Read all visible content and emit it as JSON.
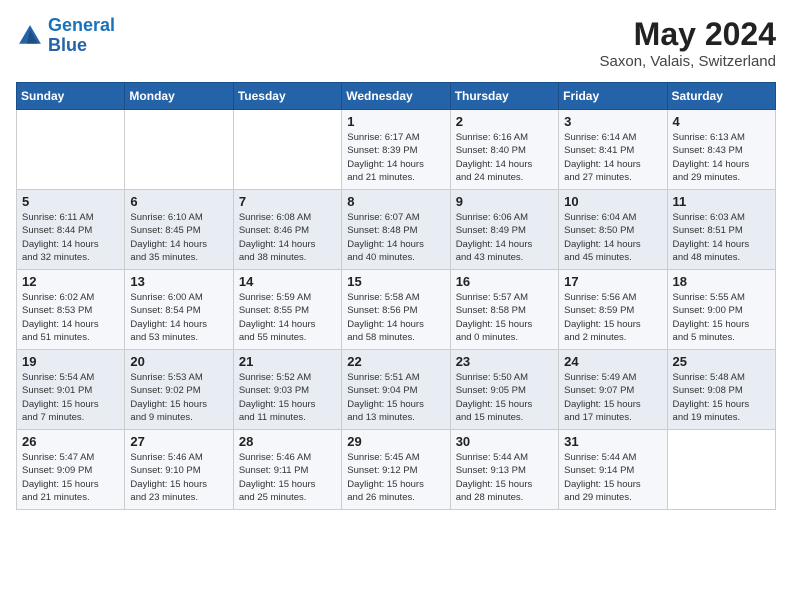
{
  "header": {
    "logo_general": "General",
    "logo_blue": "Blue",
    "month_year": "May 2024",
    "location": "Saxon, Valais, Switzerland"
  },
  "days_of_week": [
    "Sunday",
    "Monday",
    "Tuesday",
    "Wednesday",
    "Thursday",
    "Friday",
    "Saturday"
  ],
  "weeks": [
    [
      {
        "day": "",
        "info": ""
      },
      {
        "day": "",
        "info": ""
      },
      {
        "day": "",
        "info": ""
      },
      {
        "day": "1",
        "info": "Sunrise: 6:17 AM\nSunset: 8:39 PM\nDaylight: 14 hours\nand 21 minutes."
      },
      {
        "day": "2",
        "info": "Sunrise: 6:16 AM\nSunset: 8:40 PM\nDaylight: 14 hours\nand 24 minutes."
      },
      {
        "day": "3",
        "info": "Sunrise: 6:14 AM\nSunset: 8:41 PM\nDaylight: 14 hours\nand 27 minutes."
      },
      {
        "day": "4",
        "info": "Sunrise: 6:13 AM\nSunset: 8:43 PM\nDaylight: 14 hours\nand 29 minutes."
      }
    ],
    [
      {
        "day": "5",
        "info": "Sunrise: 6:11 AM\nSunset: 8:44 PM\nDaylight: 14 hours\nand 32 minutes."
      },
      {
        "day": "6",
        "info": "Sunrise: 6:10 AM\nSunset: 8:45 PM\nDaylight: 14 hours\nand 35 minutes."
      },
      {
        "day": "7",
        "info": "Sunrise: 6:08 AM\nSunset: 8:46 PM\nDaylight: 14 hours\nand 38 minutes."
      },
      {
        "day": "8",
        "info": "Sunrise: 6:07 AM\nSunset: 8:48 PM\nDaylight: 14 hours\nand 40 minutes."
      },
      {
        "day": "9",
        "info": "Sunrise: 6:06 AM\nSunset: 8:49 PM\nDaylight: 14 hours\nand 43 minutes."
      },
      {
        "day": "10",
        "info": "Sunrise: 6:04 AM\nSunset: 8:50 PM\nDaylight: 14 hours\nand 45 minutes."
      },
      {
        "day": "11",
        "info": "Sunrise: 6:03 AM\nSunset: 8:51 PM\nDaylight: 14 hours\nand 48 minutes."
      }
    ],
    [
      {
        "day": "12",
        "info": "Sunrise: 6:02 AM\nSunset: 8:53 PM\nDaylight: 14 hours\nand 51 minutes."
      },
      {
        "day": "13",
        "info": "Sunrise: 6:00 AM\nSunset: 8:54 PM\nDaylight: 14 hours\nand 53 minutes."
      },
      {
        "day": "14",
        "info": "Sunrise: 5:59 AM\nSunset: 8:55 PM\nDaylight: 14 hours\nand 55 minutes."
      },
      {
        "day": "15",
        "info": "Sunrise: 5:58 AM\nSunset: 8:56 PM\nDaylight: 14 hours\nand 58 minutes."
      },
      {
        "day": "16",
        "info": "Sunrise: 5:57 AM\nSunset: 8:58 PM\nDaylight: 15 hours\nand 0 minutes."
      },
      {
        "day": "17",
        "info": "Sunrise: 5:56 AM\nSunset: 8:59 PM\nDaylight: 15 hours\nand 2 minutes."
      },
      {
        "day": "18",
        "info": "Sunrise: 5:55 AM\nSunset: 9:00 PM\nDaylight: 15 hours\nand 5 minutes."
      }
    ],
    [
      {
        "day": "19",
        "info": "Sunrise: 5:54 AM\nSunset: 9:01 PM\nDaylight: 15 hours\nand 7 minutes."
      },
      {
        "day": "20",
        "info": "Sunrise: 5:53 AM\nSunset: 9:02 PM\nDaylight: 15 hours\nand 9 minutes."
      },
      {
        "day": "21",
        "info": "Sunrise: 5:52 AM\nSunset: 9:03 PM\nDaylight: 15 hours\nand 11 minutes."
      },
      {
        "day": "22",
        "info": "Sunrise: 5:51 AM\nSunset: 9:04 PM\nDaylight: 15 hours\nand 13 minutes."
      },
      {
        "day": "23",
        "info": "Sunrise: 5:50 AM\nSunset: 9:05 PM\nDaylight: 15 hours\nand 15 minutes."
      },
      {
        "day": "24",
        "info": "Sunrise: 5:49 AM\nSunset: 9:07 PM\nDaylight: 15 hours\nand 17 minutes."
      },
      {
        "day": "25",
        "info": "Sunrise: 5:48 AM\nSunset: 9:08 PM\nDaylight: 15 hours\nand 19 minutes."
      }
    ],
    [
      {
        "day": "26",
        "info": "Sunrise: 5:47 AM\nSunset: 9:09 PM\nDaylight: 15 hours\nand 21 minutes."
      },
      {
        "day": "27",
        "info": "Sunrise: 5:46 AM\nSunset: 9:10 PM\nDaylight: 15 hours\nand 23 minutes."
      },
      {
        "day": "28",
        "info": "Sunrise: 5:46 AM\nSunset: 9:11 PM\nDaylight: 15 hours\nand 25 minutes."
      },
      {
        "day": "29",
        "info": "Sunrise: 5:45 AM\nSunset: 9:12 PM\nDaylight: 15 hours\nand 26 minutes."
      },
      {
        "day": "30",
        "info": "Sunrise: 5:44 AM\nSunset: 9:13 PM\nDaylight: 15 hours\nand 28 minutes."
      },
      {
        "day": "31",
        "info": "Sunrise: 5:44 AM\nSunset: 9:14 PM\nDaylight: 15 hours\nand 29 minutes."
      },
      {
        "day": "",
        "info": ""
      }
    ]
  ]
}
